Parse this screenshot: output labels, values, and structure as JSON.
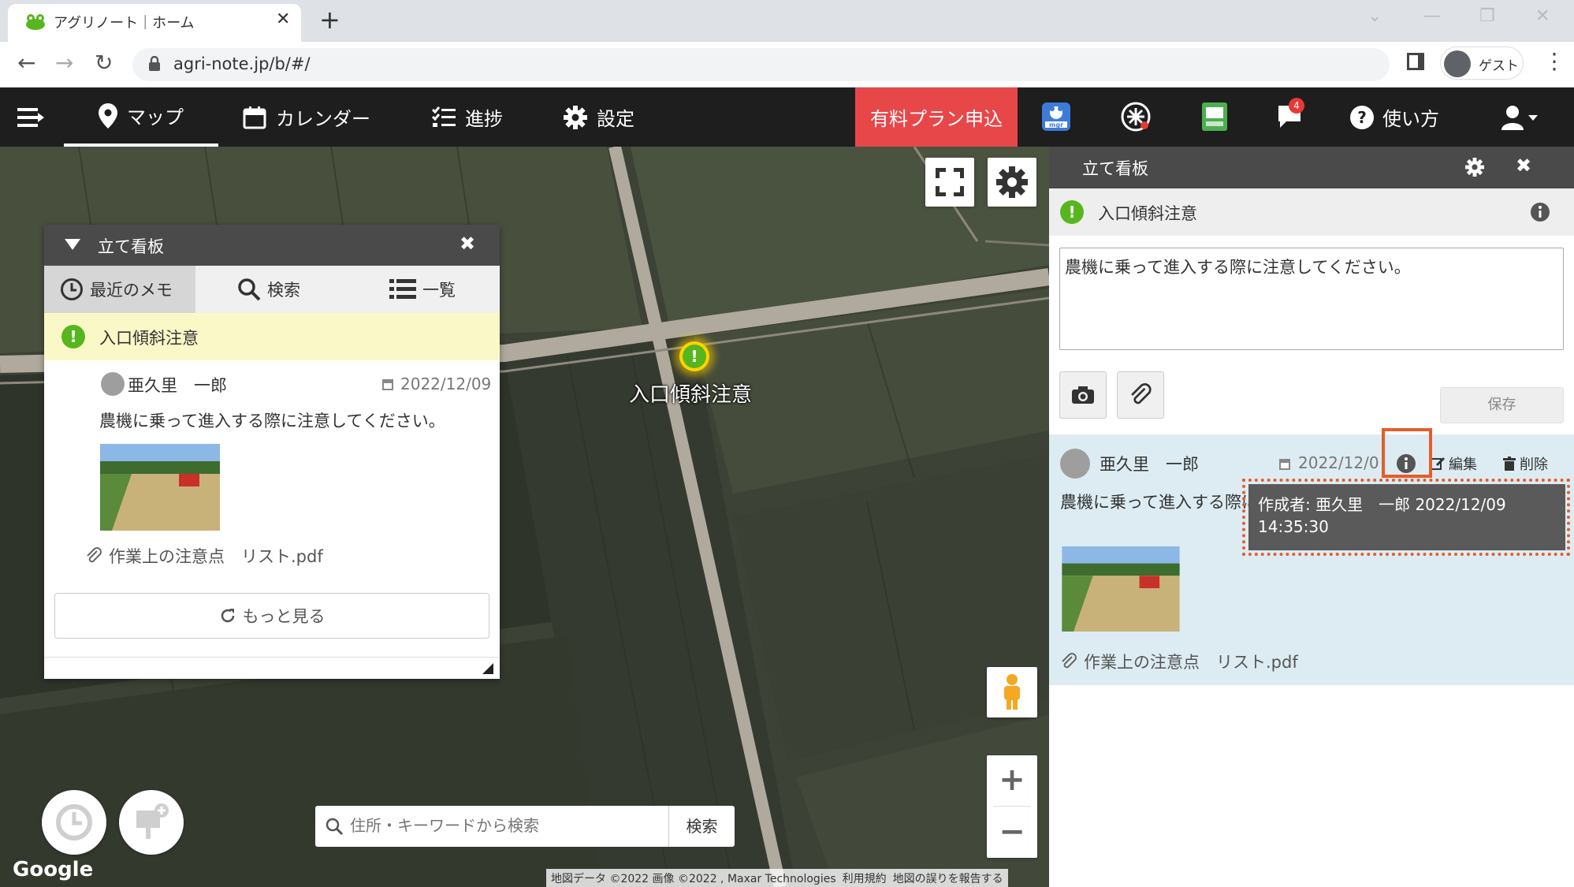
{
  "browser": {
    "tab_title": "アグリノート｜ホーム",
    "url": "agri-note.jp/b/#/",
    "profile_label": "ゲスト"
  },
  "header": {
    "nav": [
      {
        "label": "マップ",
        "icon": "map-pin-icon"
      },
      {
        "label": "カレンダー",
        "icon": "calendar-icon"
      },
      {
        "label": "進捗",
        "icon": "checklist-icon"
      },
      {
        "label": "設定",
        "icon": "gear-icon"
      }
    ],
    "paid_plan_label": "有料プラン申込",
    "notification_count": "4",
    "help_label": "使い方",
    "mgr_label": "mgr"
  },
  "map": {
    "marker_label": "入口傾斜注意",
    "search_placeholder": "住所・キーワードから検索",
    "search_button": "検索",
    "google_logo": "Google",
    "attribution": [
      "地図データ ©2022 画像 ©2022 , Maxar Technologies",
      "利用規約",
      "地図の誤りを報告する"
    ]
  },
  "float_panel": {
    "title": "立て看板",
    "tabs": [
      "最近のメモ",
      "検索",
      "一覧"
    ],
    "notice_title": "入口傾斜注意",
    "author": "亜久里　一郎",
    "date": "2022/12/09",
    "body": "農機に乗って進入する際に注意してください。",
    "attachment": "作業上の注意点　リスト.pdf",
    "more_label": "もっと見る"
  },
  "side_panel": {
    "title": "立て看板",
    "notice_title": "入口傾斜注意",
    "textarea_value": "農機に乗って進入する際に注意してください。",
    "save_label": "保存",
    "card": {
      "author": "亜久里　一郎",
      "date": "2022/12/09",
      "body": "農機に乗って進入する際に注意してください。",
      "edit_label": "編集",
      "delete_label": "削除",
      "attachment": "作業上の注意点　リスト.pdf"
    },
    "tooltip_text": "作成者: 亜久里　一郎 2022/12/09 14:35:30"
  },
  "colors": {
    "accent_red": "#e8474a",
    "header_bg": "#1e1e1e",
    "ok_green": "#57b61e",
    "highlight_orange": "#e65c2b"
  }
}
